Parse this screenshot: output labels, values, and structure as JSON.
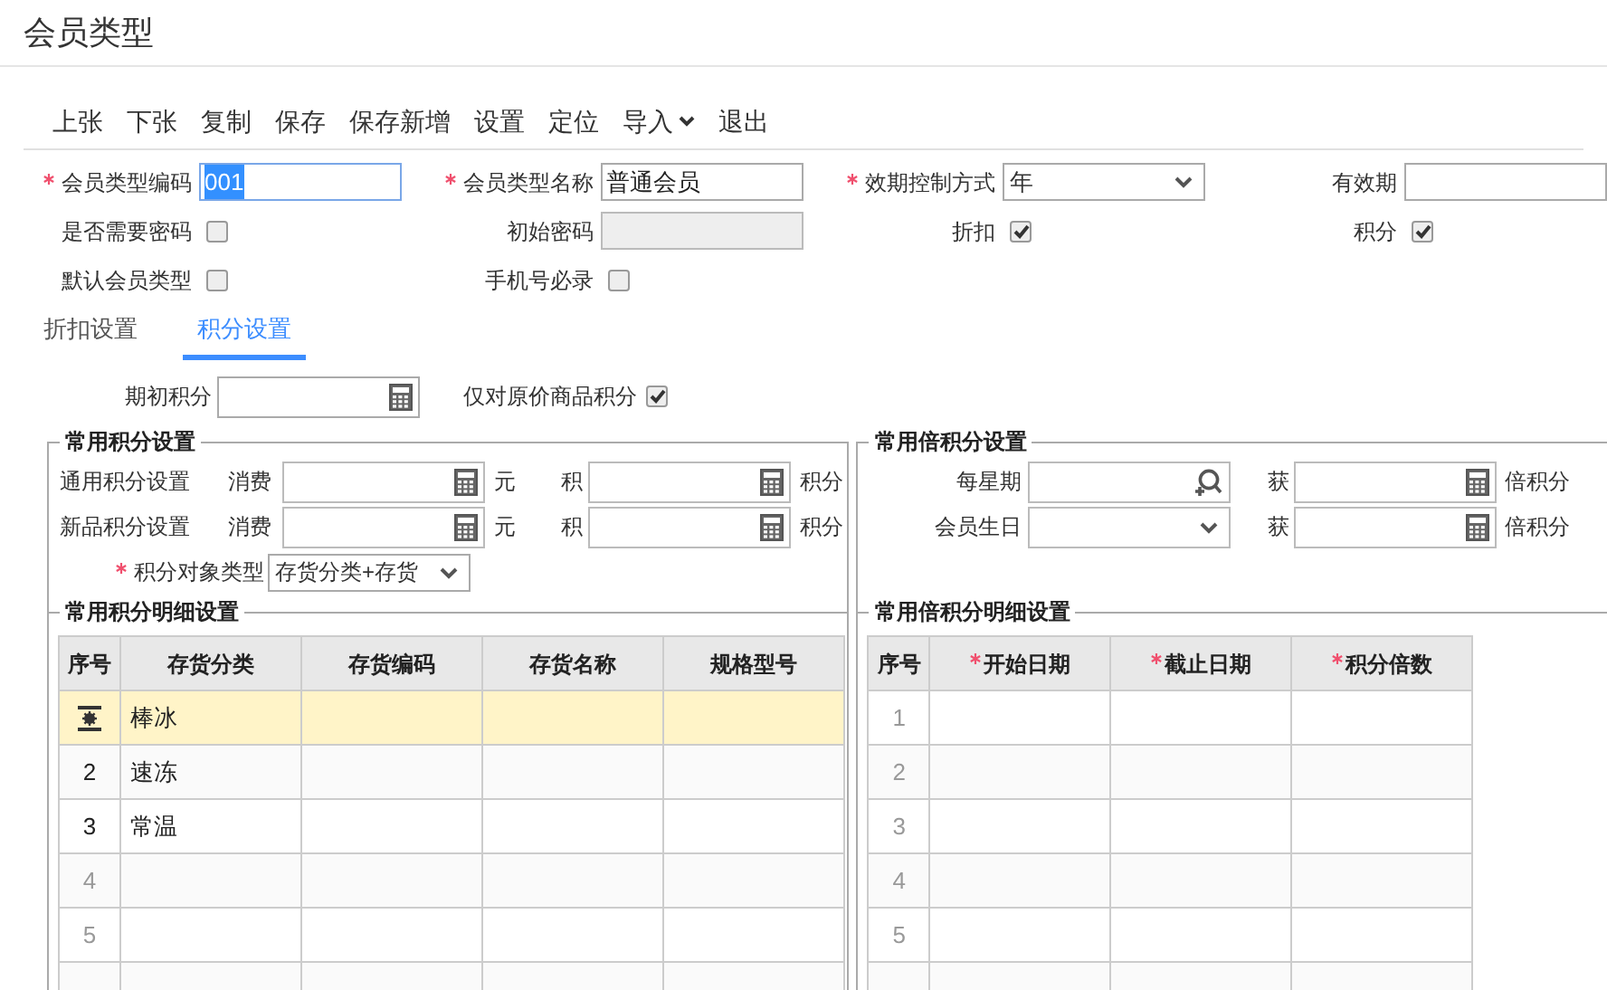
{
  "window": {
    "title": "会员类型"
  },
  "toolbar": [
    {
      "label": "上张",
      "dropdown": false
    },
    {
      "label": "下张",
      "dropdown": false
    },
    {
      "label": "复制",
      "dropdown": false
    },
    {
      "label": "保存",
      "dropdown": false
    },
    {
      "label": "保存新增",
      "dropdown": false
    },
    {
      "label": "设置",
      "dropdown": false
    },
    {
      "label": "定位",
      "dropdown": false
    },
    {
      "label": "导入",
      "dropdown": true
    },
    {
      "label": "退出",
      "dropdown": false
    }
  ],
  "form": {
    "rows": [
      [
        {
          "kind": "text",
          "label": "会员类型编码",
          "required": true,
          "value": "001",
          "focused": true
        },
        {
          "kind": "text",
          "label": "会员类型名称",
          "required": true,
          "value": "普通会员",
          "focused": false
        },
        {
          "kind": "select",
          "label": "效期控制方式",
          "required": true,
          "value": "年"
        },
        {
          "kind": "text",
          "label": "有效期",
          "required": false,
          "focused": false
        }
      ],
      [
        {
          "kind": "checkbox",
          "label": "是否需要密码",
          "checked": false
        },
        {
          "kind": "text",
          "label": "初始密码",
          "required": false,
          "disabled": true,
          "focused": false
        },
        {
          "kind": "checkbox",
          "label": "折扣",
          "checked": true
        },
        {
          "kind": "checkbox",
          "label": "积分",
          "checked": true
        }
      ],
      [
        {
          "kind": "checkbox",
          "label": "默认会员类型",
          "checked": false
        },
        {
          "kind": "checkbox",
          "label": "手机号必录",
          "checked": false
        }
      ]
    ]
  },
  "tabs": [
    {
      "label": "折扣设置",
      "selected": false
    },
    {
      "label": "积分设置",
      "selected": true
    }
  ],
  "points": {
    "opening_label": "期初积分",
    "original_price_label": "仅对原价商品积分",
    "original_price_checked": true,
    "common": {
      "legend": "常用积分设置",
      "rows": [
        {
          "label": "通用积分设置",
          "spend_label": "消费",
          "spend_unit": "元",
          "earn_label": "积",
          "earn_unit": "积分"
        },
        {
          "label": "新品积分设置",
          "spend_label": "消费",
          "spend_unit": "元",
          "earn_label": "积",
          "earn_unit": "积分"
        }
      ],
      "target_type": {
        "label": "积分对象类型",
        "required": true,
        "value": "存货分类+存货"
      }
    },
    "detail": {
      "legend": "常用积分明细设置",
      "columns": [
        "序号",
        "存货分类",
        "存货编码",
        "存货名称",
        "规格型号"
      ],
      "rows": [
        {
          "kind": "data",
          "selected": true,
          "category": "棒冰"
        },
        {
          "kind": "data",
          "selected": false,
          "number": "2",
          "category": "速冻"
        },
        {
          "kind": "data",
          "selected": false,
          "number": "3",
          "category": "常温"
        },
        {
          "kind": "empty",
          "selected": false,
          "number": "4"
        },
        {
          "kind": "empty",
          "selected": false,
          "number": "5"
        }
      ]
    },
    "multiplier": {
      "legend": "常用倍积分设置",
      "rows": [
        {
          "kind": "search",
          "label": "每星期",
          "get_label": "获",
          "unit": "倍积分"
        },
        {
          "kind": "select",
          "label": "会员生日",
          "get_label": "获",
          "unit": "倍积分"
        }
      ]
    },
    "multiplier_detail": {
      "legend": "常用倍积分明细设置",
      "columns": [
        {
          "label": "序号",
          "required": false
        },
        {
          "label": "开始日期",
          "required": true
        },
        {
          "label": "截止日期",
          "required": true
        },
        {
          "label": "积分倍数",
          "required": true
        }
      ],
      "rows": [
        {
          "number": "1"
        },
        {
          "number": "2"
        },
        {
          "number": "3"
        },
        {
          "number": "4"
        },
        {
          "number": "5"
        }
      ]
    }
  }
}
